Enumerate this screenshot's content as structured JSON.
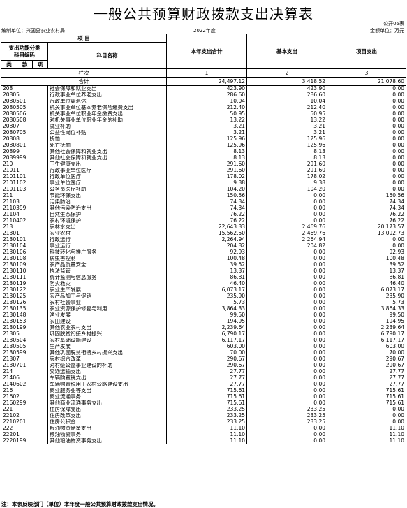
{
  "title": "一般公共预算财政拨款支出决算表",
  "form_no": "公开05表",
  "unit": "编制单位：兴国县农业农村局",
  "year": "2022年度",
  "currency": "金额单位：万元",
  "header": {
    "item": "项  目",
    "code_title": "支出功能分类\n科目编码",
    "name": "科目名称",
    "total": "本年支出合计",
    "basic": "基本支出",
    "project": "项目支出",
    "lei": "类",
    "kuan": "款",
    "xiang": "项",
    "lanci": "栏次",
    "heji": "合计",
    "c1": "1",
    "c2": "2",
    "c3": "3"
  },
  "totals": {
    "total": "24,497.12",
    "basic": "3,418.52",
    "project": "21,078.60"
  },
  "rows": [
    {
      "code": "208",
      "name": "社会保障和就业支出",
      "lvl": 1,
      "total": "423.90",
      "basic": "423.90",
      "project": "0.00"
    },
    {
      "code": "20805",
      "name": "行政事业单位养老支出",
      "lvl": 1,
      "total": "286.60",
      "basic": "286.60",
      "project": "0.00"
    },
    {
      "code": "2080501",
      "name": "行政单位离退休",
      "lvl": 2,
      "total": "10.04",
      "basic": "10.04",
      "project": "0.00"
    },
    {
      "code": "2080505",
      "name": "机关事业单位基本养老保险缴费支出",
      "lvl": 2,
      "total": "212.40",
      "basic": "212.40",
      "project": "0.00"
    },
    {
      "code": "2080506",
      "name": "机关事业单位职业年金缴费支出",
      "lvl": 2,
      "total": "50.95",
      "basic": "50.95",
      "project": "0.00"
    },
    {
      "code": "2080508",
      "name": "对机关事业单位职业年金的补助",
      "lvl": 2,
      "total": "13.22",
      "basic": "13.22",
      "project": "0.00"
    },
    {
      "code": "20807",
      "name": "就业补助",
      "lvl": 1,
      "total": "3.21",
      "basic": "3.21",
      "project": "0.00"
    },
    {
      "code": "2080705",
      "name": "公益性岗位补贴",
      "lvl": 2,
      "total": "3.21",
      "basic": "3.21",
      "project": "0.00"
    },
    {
      "code": "20808",
      "name": "抚恤",
      "lvl": 1,
      "total": "125.96",
      "basic": "125.96",
      "project": "0.00"
    },
    {
      "code": "2080801",
      "name": "死亡抚恤",
      "lvl": 2,
      "total": "125.96",
      "basic": "125.96",
      "project": "0.00"
    },
    {
      "code": "20899",
      "name": "其他社会保障和就业支出",
      "lvl": 1,
      "total": "8.13",
      "basic": "8.13",
      "project": "0.00"
    },
    {
      "code": "2089999",
      "name": "其他社会保障和就业支出",
      "lvl": 2,
      "total": "8.13",
      "basic": "8.13",
      "project": "0.00"
    },
    {
      "code": "210",
      "name": "卫生健康支出",
      "lvl": 1,
      "total": "291.60",
      "basic": "291.60",
      "project": "0.00"
    },
    {
      "code": "21011",
      "name": "行政事业单位医疗",
      "lvl": 1,
      "total": "291.60",
      "basic": "291.60",
      "project": "0.00"
    },
    {
      "code": "2101101",
      "name": "行政单位医疗",
      "lvl": 2,
      "total": "178.02",
      "basic": "178.02",
      "project": "0.00"
    },
    {
      "code": "2101102",
      "name": "事业单位医疗",
      "lvl": 2,
      "total": "9.38",
      "basic": "9.38",
      "project": "0.00"
    },
    {
      "code": "2101103",
      "name": "公务员医疗补助",
      "lvl": 2,
      "total": "104.20",
      "basic": "104.20",
      "project": "0.00"
    },
    {
      "code": "211",
      "name": "节能环保支出",
      "lvl": 1,
      "total": "150.56",
      "basic": "0.00",
      "project": "150.56"
    },
    {
      "code": "21103",
      "name": "污染防治",
      "lvl": 1,
      "total": "74.34",
      "basic": "0.00",
      "project": "74.34"
    },
    {
      "code": "2110399",
      "name": "其他污染防治支出",
      "lvl": 2,
      "total": "74.34",
      "basic": "0.00",
      "project": "74.34"
    },
    {
      "code": "21104",
      "name": "自然生态保护",
      "lvl": 1,
      "total": "76.22",
      "basic": "0.00",
      "project": "76.22"
    },
    {
      "code": "2110402",
      "name": "农村环境保护",
      "lvl": 2,
      "total": "76.22",
      "basic": "0.00",
      "project": "76.22"
    },
    {
      "code": "213",
      "name": "农林水支出",
      "lvl": 1,
      "total": "22,643.33",
      "basic": "2,469.76",
      "project": "20,173.57"
    },
    {
      "code": "21301",
      "name": "农业农村",
      "lvl": 1,
      "total": "15,562.50",
      "basic": "2,469.76",
      "project": "13,092.73"
    },
    {
      "code": "2130101",
      "name": "行政运行",
      "lvl": 2,
      "total": "2,264.94",
      "basic": "2,264.94",
      "project": "0.00"
    },
    {
      "code": "2130104",
      "name": "事业运行",
      "lvl": 2,
      "total": "204.82",
      "basic": "204.82",
      "project": "0.00"
    },
    {
      "code": "2130106",
      "name": "科技转化与推广服务",
      "lvl": 2,
      "total": "92.93",
      "basic": "0.00",
      "project": "92.93"
    },
    {
      "code": "2130108",
      "name": "病虫害控制",
      "lvl": 2,
      "total": "100.48",
      "basic": "0.00",
      "project": "100.48"
    },
    {
      "code": "2130109",
      "name": "农产品质量安全",
      "lvl": 2,
      "total": "39.52",
      "basic": "0.00",
      "project": "39.52"
    },
    {
      "code": "2130110",
      "name": "执法监管",
      "lvl": 2,
      "total": "13.37",
      "basic": "0.00",
      "project": "13.37"
    },
    {
      "code": "2130111",
      "name": "统计监测与信息服务",
      "lvl": 2,
      "total": "86.81",
      "basic": "0.00",
      "project": "86.81"
    },
    {
      "code": "2130119",
      "name": "防灾救灾",
      "lvl": 2,
      "total": "46.40",
      "basic": "0.00",
      "project": "46.40"
    },
    {
      "code": "2130122",
      "name": "农业生产发展",
      "lvl": 2,
      "total": "6,073.17",
      "basic": "0.00",
      "project": "6,073.17"
    },
    {
      "code": "2130125",
      "name": "农产品加工与促销",
      "lvl": 2,
      "total": "235.90",
      "basic": "0.00",
      "project": "235.90"
    },
    {
      "code": "2130126",
      "name": "农村社会事业",
      "lvl": 2,
      "total": "5.73",
      "basic": "0.00",
      "project": "5.73"
    },
    {
      "code": "2130135",
      "name": "农业资源保护修复与利用",
      "lvl": 2,
      "total": "3,864.33",
      "basic": "0.00",
      "project": "3,864.33"
    },
    {
      "code": "2130148",
      "name": "渔业发展",
      "lvl": 2,
      "total": "99.50",
      "basic": "0.00",
      "project": "99.50"
    },
    {
      "code": "2130153",
      "name": "农田建设",
      "lvl": 2,
      "total": "194.95",
      "basic": "0.00",
      "project": "194.95"
    },
    {
      "code": "2130199",
      "name": "其他农业农村支出",
      "lvl": 2,
      "total": "2,239.64",
      "basic": "0.00",
      "project": "2,239.64"
    },
    {
      "code": "21305",
      "name": "巩固脱贫衔接乡村振兴",
      "lvl": 1,
      "total": "6,790.17",
      "basic": "0.00",
      "project": "6,790.17"
    },
    {
      "code": "2130504",
      "name": "农村基础设施建设",
      "lvl": 2,
      "total": "6,117.17",
      "basic": "0.00",
      "project": "6,117.17"
    },
    {
      "code": "2130505",
      "name": "生产发展",
      "lvl": 2,
      "total": "603.00",
      "basic": "0.00",
      "project": "603.00"
    },
    {
      "code": "2130599",
      "name": "其他巩固脱贫衔接乡村振兴支出",
      "lvl": 2,
      "total": "70.00",
      "basic": "0.00",
      "project": "70.00"
    },
    {
      "code": "21307",
      "name": "农村综合改革",
      "lvl": 1,
      "total": "290.67",
      "basic": "0.00",
      "project": "290.67"
    },
    {
      "code": "2130701",
      "name": "对村级公益事业建设的补助",
      "lvl": 2,
      "total": "290.67",
      "basic": "0.00",
      "project": "290.67"
    },
    {
      "code": "214",
      "name": "交通运输支出",
      "lvl": 1,
      "total": "27.77",
      "basic": "0.00",
      "project": "27.77"
    },
    {
      "code": "21406",
      "name": "车辆购置税支出",
      "lvl": 1,
      "total": "27.77",
      "basic": "0.00",
      "project": "27.77"
    },
    {
      "code": "2140602",
      "name": "车辆购置税用于农村公路建设支出",
      "lvl": 2,
      "total": "27.77",
      "basic": "0.00",
      "project": "27.77"
    },
    {
      "code": "216",
      "name": "商业服务业等支出",
      "lvl": 1,
      "total": "715.61",
      "basic": "0.00",
      "project": "715.61"
    },
    {
      "code": "21602",
      "name": "商业流通事务",
      "lvl": 1,
      "total": "715.61",
      "basic": "0.00",
      "project": "715.61"
    },
    {
      "code": "2160299",
      "name": "其他商业流通事务支出",
      "lvl": 2,
      "total": "715.61",
      "basic": "0.00",
      "project": "715.61"
    },
    {
      "code": "221",
      "name": "住房保障支出",
      "lvl": 1,
      "total": "233.25",
      "basic": "233.25",
      "project": "0.00"
    },
    {
      "code": "22102",
      "name": "住房改革支出",
      "lvl": 1,
      "total": "233.25",
      "basic": "233.25",
      "project": "0.00"
    },
    {
      "code": "2210201",
      "name": "住房公积金",
      "lvl": 2,
      "total": "233.25",
      "basic": "233.25",
      "project": "0.00"
    },
    {
      "code": "222",
      "name": "粮油物资储备支出",
      "lvl": 1,
      "total": "11.10",
      "basic": "0.00",
      "project": "11.10"
    },
    {
      "code": "22201",
      "name": "粮油物资事务",
      "lvl": 1,
      "total": "11.10",
      "basic": "0.00",
      "project": "11.10"
    },
    {
      "code": "2220199",
      "name": "其他粮油物资事务支出",
      "lvl": 2,
      "total": "11.10",
      "basic": "0.00",
      "project": "11.10"
    }
  ],
  "note": "注：本表反映部门（单位）本年度一般公共预算财政拨款支出情况。"
}
